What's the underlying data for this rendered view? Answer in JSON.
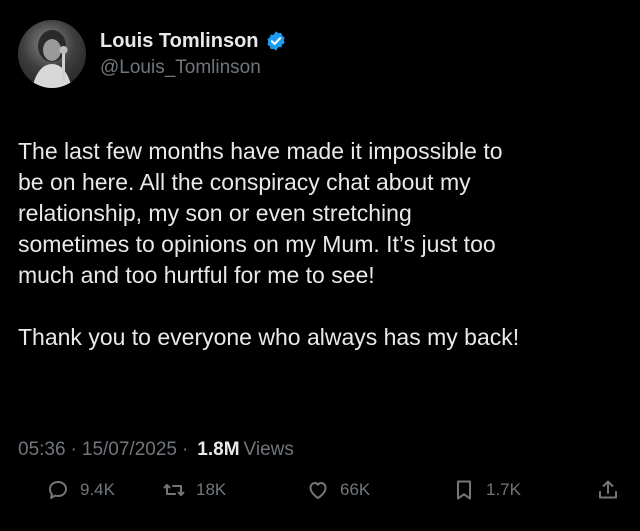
{
  "author": {
    "display_name": "Louis Tomlinson",
    "handle": "@Louis_Tomlinson",
    "verified": true,
    "verified_color": "#1d9bf0"
  },
  "tweet": {
    "text": "The last few months have made it impossible to\nbe on here. All the conspiracy chat about my\nrelationship, my son or even stretching\nsometimes to opinions on my Mum. It’s just too\nmuch and too hurtful for me to see!\n\nThank you to everyone who always has my back!"
  },
  "meta": {
    "time": "05:36",
    "date": "15/07/2025",
    "separator": "·",
    "views_count": "1.8M",
    "views_label": "Views"
  },
  "actions": {
    "replies": "9.4K",
    "reposts": "18K",
    "likes": "66K",
    "bookmarks": "1.7K"
  },
  "icons": [
    "verified-badge-icon",
    "reply-icon",
    "repost-icon",
    "like-icon",
    "bookmark-icon",
    "share-icon"
  ]
}
